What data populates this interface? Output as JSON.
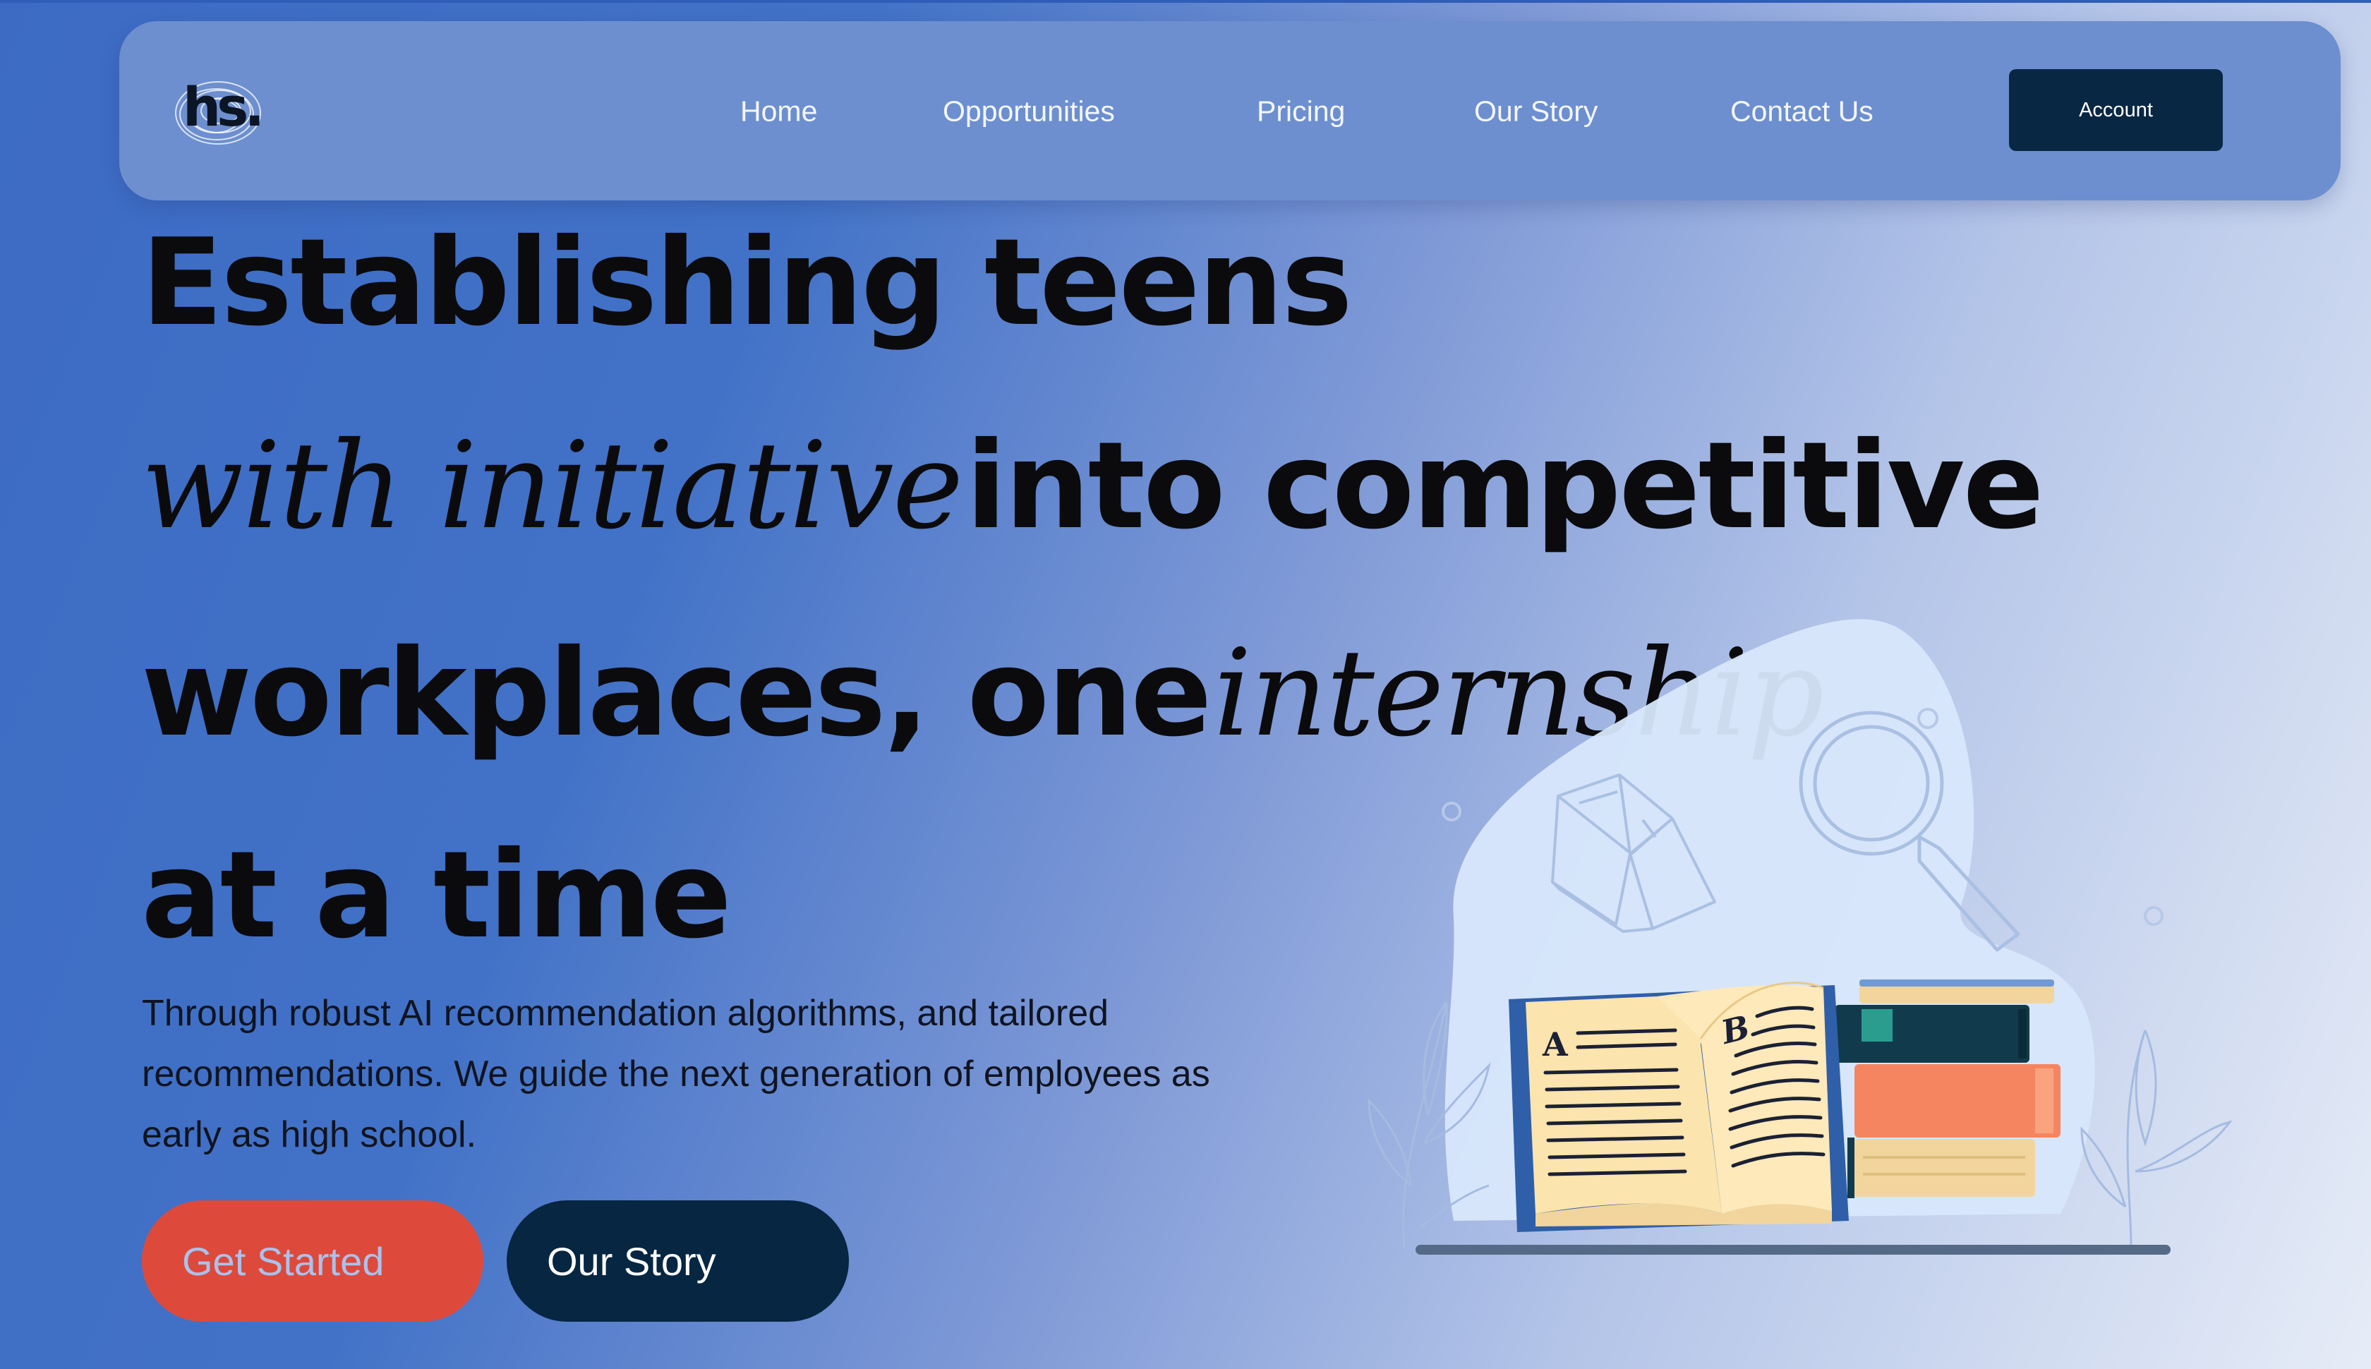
{
  "brand": {
    "logo_text": "hs."
  },
  "nav": {
    "links": [
      "Home",
      "Opportunities",
      "Pricing",
      "Our Story",
      "Contact Us"
    ],
    "account_label": "Account"
  },
  "hero": {
    "line1": "Establishing teens",
    "line2_italic": "with initiative",
    "line2_bold": "into competitive",
    "line3_bold": "workplaces, one",
    "line3_italic": "internship",
    "line4": "at a time",
    "subtitle": "Through robust AI recommendation algorithms, and tailored recommendations. We guide the next generation of employees as early as high school.",
    "cta_primary": "Get Started",
    "cta_secondary": "Our Story"
  },
  "illustration": {
    "icons": [
      "open-book-outline-icon",
      "magnifier-icon",
      "open-book-icon",
      "book-stack-icon",
      "plant-outline-icon"
    ],
    "page_letters": [
      "A",
      "B"
    ]
  },
  "colors": {
    "navbar": "#6d8fcf",
    "account_button": "#082743",
    "cta_primary": "#dd4a3c",
    "cta_secondary": "#062641",
    "headline": "#0b0b0d"
  }
}
